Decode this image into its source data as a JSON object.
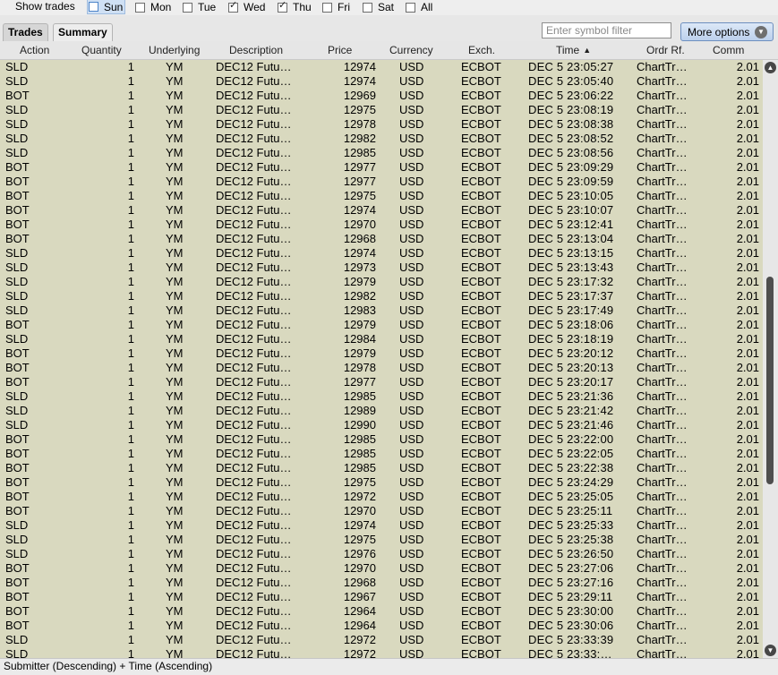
{
  "filter": {
    "show_trades_label": "Show trades",
    "days": [
      {
        "label": "Sun",
        "checked": false,
        "highlighted": true
      },
      {
        "label": "Mon",
        "checked": false
      },
      {
        "label": "Tue",
        "checked": false
      },
      {
        "label": "Wed",
        "checked": true
      },
      {
        "label": "Thu",
        "checked": true
      },
      {
        "label": "Fri",
        "checked": false
      },
      {
        "label": "Sat",
        "checked": false
      },
      {
        "label": "All",
        "checked": false
      }
    ]
  },
  "tabs": [
    {
      "label": "Trades",
      "active": false
    },
    {
      "label": "Summary",
      "active": true
    }
  ],
  "symbol_filter": {
    "placeholder": "Enter symbol filter"
  },
  "more_options": {
    "label": "More options"
  },
  "columns": [
    "Action",
    "Quantity",
    "Underlying",
    "Description",
    "Price",
    "Currency",
    "Exch.",
    "Time",
    "Ordr Rf.",
    "Comm"
  ],
  "sort_column": "Time",
  "rows": [
    [
      "SLD",
      "1",
      "YM",
      "DEC12 Futu…",
      "12974",
      "USD",
      "ECBOT",
      "DEC 5 23:05:27",
      "ChartTr…",
      "2.01"
    ],
    [
      "SLD",
      "1",
      "YM",
      "DEC12 Futu…",
      "12974",
      "USD",
      "ECBOT",
      "DEC 5 23:05:40",
      "ChartTr…",
      "2.01"
    ],
    [
      "BOT",
      "1",
      "YM",
      "DEC12 Futu…",
      "12969",
      "USD",
      "ECBOT",
      "DEC 5 23:06:22",
      "ChartTr…",
      "2.01"
    ],
    [
      "SLD",
      "1",
      "YM",
      "DEC12 Futu…",
      "12975",
      "USD",
      "ECBOT",
      "DEC 5 23:08:19",
      "ChartTr…",
      "2.01"
    ],
    [
      "SLD",
      "1",
      "YM",
      "DEC12 Futu…",
      "12978",
      "USD",
      "ECBOT",
      "DEC 5 23:08:38",
      "ChartTr…",
      "2.01"
    ],
    [
      "SLD",
      "1",
      "YM",
      "DEC12 Futu…",
      "12982",
      "USD",
      "ECBOT",
      "DEC 5 23:08:52",
      "ChartTr…",
      "2.01"
    ],
    [
      "SLD",
      "1",
      "YM",
      "DEC12 Futu…",
      "12985",
      "USD",
      "ECBOT",
      "DEC 5 23:08:56",
      "ChartTr…",
      "2.01"
    ],
    [
      "BOT",
      "1",
      "YM",
      "DEC12 Futu…",
      "12977",
      "USD",
      "ECBOT",
      "DEC 5 23:09:29",
      "ChartTr…",
      "2.01"
    ],
    [
      "BOT",
      "1",
      "YM",
      "DEC12 Futu…",
      "12977",
      "USD",
      "ECBOT",
      "DEC 5 23:09:59",
      "ChartTr…",
      "2.01"
    ],
    [
      "BOT",
      "1",
      "YM",
      "DEC12 Futu…",
      "12975",
      "USD",
      "ECBOT",
      "DEC 5 23:10:05",
      "ChartTr…",
      "2.01"
    ],
    [
      "BOT",
      "1",
      "YM",
      "DEC12 Futu…",
      "12974",
      "USD",
      "ECBOT",
      "DEC 5 23:10:07",
      "ChartTr…",
      "2.01"
    ],
    [
      "BOT",
      "1",
      "YM",
      "DEC12 Futu…",
      "12970",
      "USD",
      "ECBOT",
      "DEC 5 23:12:41",
      "ChartTr…",
      "2.01"
    ],
    [
      "BOT",
      "1",
      "YM",
      "DEC12 Futu…",
      "12968",
      "USD",
      "ECBOT",
      "DEC 5 23:13:04",
      "ChartTr…",
      "2.01"
    ],
    [
      "SLD",
      "1",
      "YM",
      "DEC12 Futu…",
      "12974",
      "USD",
      "ECBOT",
      "DEC 5 23:13:15",
      "ChartTr…",
      "2.01"
    ],
    [
      "SLD",
      "1",
      "YM",
      "DEC12 Futu…",
      "12973",
      "USD",
      "ECBOT",
      "DEC 5 23:13:43",
      "ChartTr…",
      "2.01"
    ],
    [
      "SLD",
      "1",
      "YM",
      "DEC12 Futu…",
      "12979",
      "USD",
      "ECBOT",
      "DEC 5 23:17:32",
      "ChartTr…",
      "2.01"
    ],
    [
      "SLD",
      "1",
      "YM",
      "DEC12 Futu…",
      "12982",
      "USD",
      "ECBOT",
      "DEC 5 23:17:37",
      "ChartTr…",
      "2.01"
    ],
    [
      "SLD",
      "1",
      "YM",
      "DEC12 Futu…",
      "12983",
      "USD",
      "ECBOT",
      "DEC 5 23:17:49",
      "ChartTr…",
      "2.01"
    ],
    [
      "BOT",
      "1",
      "YM",
      "DEC12 Futu…",
      "12979",
      "USD",
      "ECBOT",
      "DEC 5 23:18:06",
      "ChartTr…",
      "2.01"
    ],
    [
      "SLD",
      "1",
      "YM",
      "DEC12 Futu…",
      "12984",
      "USD",
      "ECBOT",
      "DEC 5 23:18:19",
      "ChartTr…",
      "2.01"
    ],
    [
      "BOT",
      "1",
      "YM",
      "DEC12 Futu…",
      "12979",
      "USD",
      "ECBOT",
      "DEC 5 23:20:12",
      "ChartTr…",
      "2.01"
    ],
    [
      "BOT",
      "1",
      "YM",
      "DEC12 Futu…",
      "12978",
      "USD",
      "ECBOT",
      "DEC 5 23:20:13",
      "ChartTr…",
      "2.01"
    ],
    [
      "BOT",
      "1",
      "YM",
      "DEC12 Futu…",
      "12977",
      "USD",
      "ECBOT",
      "DEC 5 23:20:17",
      "ChartTr…",
      "2.01"
    ],
    [
      "SLD",
      "1",
      "YM",
      "DEC12 Futu…",
      "12985",
      "USD",
      "ECBOT",
      "DEC 5 23:21:36",
      "ChartTr…",
      "2.01"
    ],
    [
      "SLD",
      "1",
      "YM",
      "DEC12 Futu…",
      "12989",
      "USD",
      "ECBOT",
      "DEC 5 23:21:42",
      "ChartTr…",
      "2.01"
    ],
    [
      "SLD",
      "1",
      "YM",
      "DEC12 Futu…",
      "12990",
      "USD",
      "ECBOT",
      "DEC 5 23:21:46",
      "ChartTr…",
      "2.01"
    ],
    [
      "BOT",
      "1",
      "YM",
      "DEC12 Futu…",
      "12985",
      "USD",
      "ECBOT",
      "DEC 5 23:22:00",
      "ChartTr…",
      "2.01"
    ],
    [
      "BOT",
      "1",
      "YM",
      "DEC12 Futu…",
      "12985",
      "USD",
      "ECBOT",
      "DEC 5 23:22:05",
      "ChartTr…",
      "2.01"
    ],
    [
      "BOT",
      "1",
      "YM",
      "DEC12 Futu…",
      "12985",
      "USD",
      "ECBOT",
      "DEC 5 23:22:38",
      "ChartTr…",
      "2.01"
    ],
    [
      "BOT",
      "1",
      "YM",
      "DEC12 Futu…",
      "12975",
      "USD",
      "ECBOT",
      "DEC 5 23:24:29",
      "ChartTr…",
      "2.01"
    ],
    [
      "BOT",
      "1",
      "YM",
      "DEC12 Futu…",
      "12972",
      "USD",
      "ECBOT",
      "DEC 5 23:25:05",
      "ChartTr…",
      "2.01"
    ],
    [
      "BOT",
      "1",
      "YM",
      "DEC12 Futu…",
      "12970",
      "USD",
      "ECBOT",
      "DEC 5 23:25:11",
      "ChartTr…",
      "2.01"
    ],
    [
      "SLD",
      "1",
      "YM",
      "DEC12 Futu…",
      "12974",
      "USD",
      "ECBOT",
      "DEC 5 23:25:33",
      "ChartTr…",
      "2.01"
    ],
    [
      "SLD",
      "1",
      "YM",
      "DEC12 Futu…",
      "12975",
      "USD",
      "ECBOT",
      "DEC 5 23:25:38",
      "ChartTr…",
      "2.01"
    ],
    [
      "SLD",
      "1",
      "YM",
      "DEC12 Futu…",
      "12976",
      "USD",
      "ECBOT",
      "DEC 5 23:26:50",
      "ChartTr…",
      "2.01"
    ],
    [
      "BOT",
      "1",
      "YM",
      "DEC12 Futu…",
      "12970",
      "USD",
      "ECBOT",
      "DEC 5 23:27:06",
      "ChartTr…",
      "2.01"
    ],
    [
      "BOT",
      "1",
      "YM",
      "DEC12 Futu…",
      "12968",
      "USD",
      "ECBOT",
      "DEC 5 23:27:16",
      "ChartTr…",
      "2.01"
    ],
    [
      "BOT",
      "1",
      "YM",
      "DEC12 Futu…",
      "12967",
      "USD",
      "ECBOT",
      "DEC 5 23:29:11",
      "ChartTr…",
      "2.01"
    ],
    [
      "BOT",
      "1",
      "YM",
      "DEC12 Futu…",
      "12964",
      "USD",
      "ECBOT",
      "DEC 5 23:30:00",
      "ChartTr…",
      "2.01"
    ],
    [
      "BOT",
      "1",
      "YM",
      "DEC12 Futu…",
      "12964",
      "USD",
      "ECBOT",
      "DEC 5 23:30:06",
      "ChartTr…",
      "2.01"
    ],
    [
      "SLD",
      "1",
      "YM",
      "DEC12 Futu…",
      "12972",
      "USD",
      "ECBOT",
      "DEC 5 23:33:39",
      "ChartTr…",
      "2.01"
    ],
    [
      "SLD",
      "1",
      "YM",
      "DEC12 Futu…",
      "12972",
      "USD",
      "ECBOT",
      "DEC 5 23:33:…",
      "ChartTr…",
      "2.01"
    ]
  ],
  "footer": {
    "sort_text": "Submitter (Descending)  +  Time (Ascending)"
  },
  "colors": {
    "row_background": "#d9d9bf",
    "accent": "#bcd0ec"
  }
}
